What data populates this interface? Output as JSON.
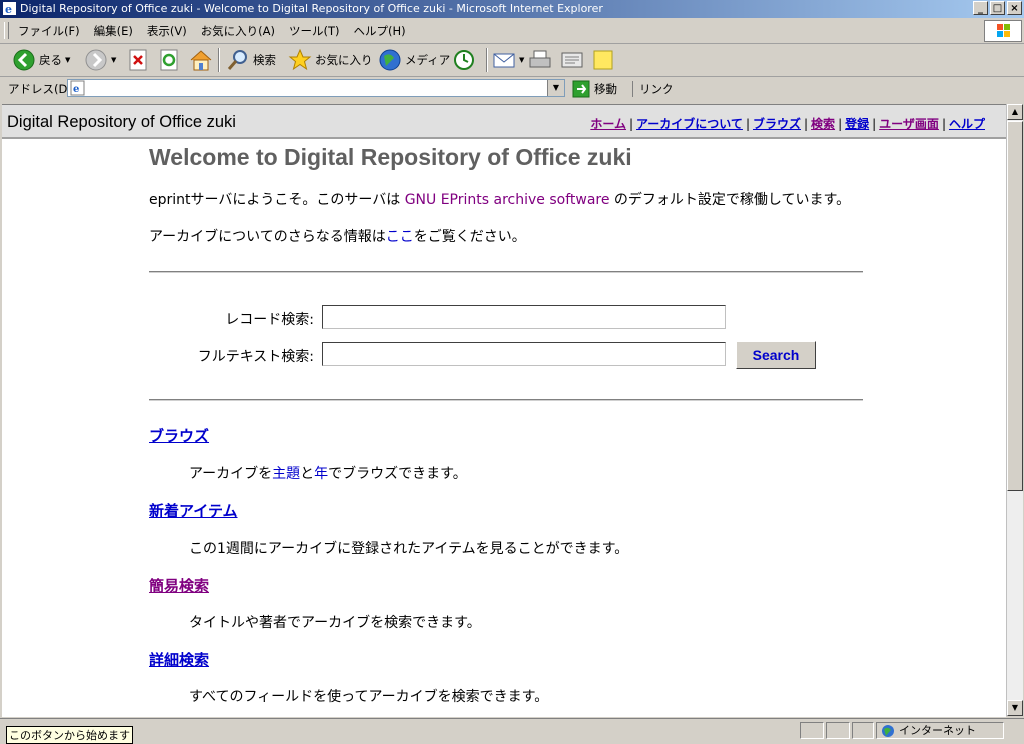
{
  "window": {
    "title": "Digital Repository of Office zuki - Welcome to Digital Repository of Office zuki - Microsoft Internet Explorer",
    "minimize": "_",
    "maximize": "□",
    "close": "×"
  },
  "menu": [
    "ファイル(F)",
    "編集(E)",
    "表示(V)",
    "お気に入り(A)",
    "ツール(T)",
    "ヘルプ(H)"
  ],
  "toolbar": {
    "back": "戻る",
    "search": "検索",
    "favorites": "お気に入り",
    "media": "メディア"
  },
  "address": {
    "label": "アドレス(D)",
    "value": "",
    "go": "移動",
    "links": "リンク"
  },
  "site": {
    "title": "Digital Repository of Office zuki",
    "nav": [
      "ホーム",
      "アーカイブについて",
      "ブラウズ",
      "検索",
      "登録",
      "ユーザ画面",
      "ヘルプ"
    ]
  },
  "page": {
    "heading": "Welcome to Digital Repository of Office zuki",
    "intro_prefix": "eprintサーバにようこそ。このサーバは ",
    "intro_link": "GNU EPrints archive software",
    "intro_suffix": " のデフォルト設定で稼働しています。",
    "info_prefix": "アーカイブについてのさらなる情報は",
    "info_link": "ここ",
    "info_suffix": "をご覧ください。",
    "record_search_label": "レコード検索:",
    "fulltext_search_label": "フルテキスト検索:",
    "search_button": "Search",
    "sections": [
      {
        "title": "ブラウズ",
        "desc_prefix": "アーカイブを",
        "link1": "主題",
        "mid": "と",
        "link2": "年",
        "desc_suffix": "でブラウズできます。"
      },
      {
        "title": "新着アイテム",
        "desc": "この1週間にアーカイブに登録されたアイテムを見ることができます。"
      },
      {
        "title": "簡易検索",
        "desc": "タイトルや著者でアーカイブを検索できます。"
      },
      {
        "title": "詳細検索",
        "desc": "すべてのフィールドを使ってアーカイブを検索できます。"
      }
    ]
  },
  "status": {
    "text": "このボタンから始めます",
    "zone": "インターネット"
  }
}
